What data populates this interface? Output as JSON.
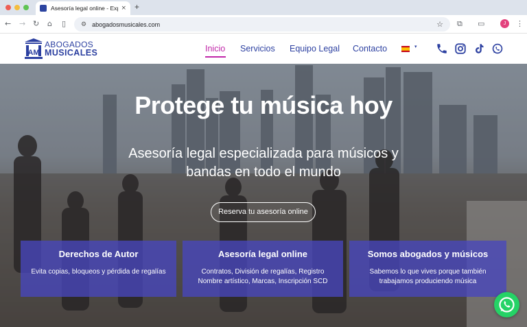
{
  "browser": {
    "tab_title": "Asesoría legal online - Expert",
    "tab_close": "×",
    "new_tab": "+",
    "url": "abogadosmusicales.com",
    "profile_initial": "J"
  },
  "site": {
    "logo_line1": "ABOGADOS",
    "logo_line2": "MUSICALES",
    "logo_monogram": "AM",
    "nav": [
      {
        "label": "Inicio"
      },
      {
        "label": "Servicios"
      },
      {
        "label": "Equipo Legal"
      },
      {
        "label": "Contacto"
      }
    ],
    "language_caret": "▾"
  },
  "hero": {
    "title": "Protege tu música hoy",
    "subtitle": "Asesoría legal especializada para músicos y bandas en todo el mundo",
    "cta": "Reserva tu asesoría online",
    "cards": [
      {
        "title": "Derechos de Autor",
        "text": "Evita copias, bloqueos y pérdida de regalías"
      },
      {
        "title": "Asesoría legal online",
        "text": "Contratos, División de regalías, Registro Nombre artístico, Marcas, Inscripción SCD"
      },
      {
        "title": "Somos abogados y músicos",
        "text": "Sabemos lo que vives porque también trabajamos produciendo música"
      }
    ]
  },
  "icons": {
    "back": "back-arrow-icon",
    "forward": "forward-arrow-icon",
    "reload": "reload-icon",
    "home": "home-icon",
    "phone": "phone-icon",
    "instagram": "instagram-icon",
    "tiktok": "tiktok-icon",
    "whatsapp": "whatsapp-icon"
  },
  "colors": {
    "brand_blue": "#2b3fa0",
    "active_pink": "#c026a8",
    "card_purple": "#4846be",
    "whatsapp_green": "#25d366"
  }
}
